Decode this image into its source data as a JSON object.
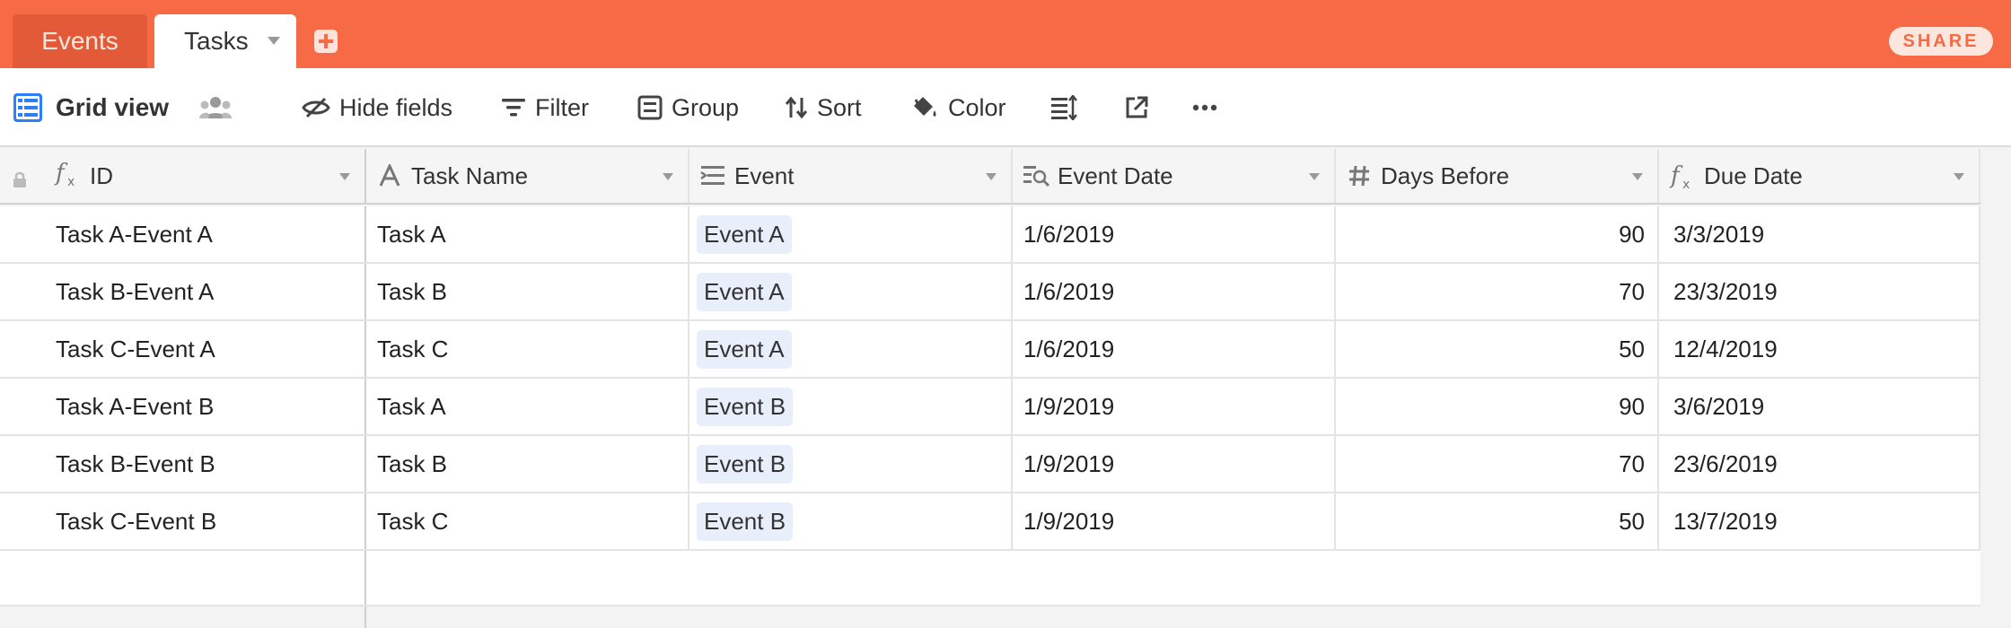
{
  "tabs": [
    {
      "label": "Events"
    },
    {
      "label": "Tasks"
    }
  ],
  "share_label": "SHARE",
  "toolbar": {
    "view_name": "Grid view",
    "hide_fields": "Hide fields",
    "filter": "Filter",
    "group": "Group",
    "sort": "Sort",
    "color": "Color"
  },
  "columns": [
    {
      "label": "ID",
      "icon": "formula-icon"
    },
    {
      "label": "Task Name",
      "icon": "text-icon"
    },
    {
      "label": "Event",
      "icon": "link-icon"
    },
    {
      "label": "Event Date",
      "icon": "lookup-icon"
    },
    {
      "label": "Days Before",
      "icon": "number-icon"
    },
    {
      "label": "Due Date",
      "icon": "formula-icon"
    }
  ],
  "rows": [
    {
      "id": "Task A-Event A",
      "task": "Task A",
      "event": "Event A",
      "event_date": "1/6/2019",
      "days_before": "90",
      "due_date": "3/3/2019"
    },
    {
      "id": "Task B-Event A",
      "task": "Task B",
      "event": "Event A",
      "event_date": "1/6/2019",
      "days_before": "70",
      "due_date": "23/3/2019"
    },
    {
      "id": "Task C-Event A",
      "task": "Task C",
      "event": "Event A",
      "event_date": "1/6/2019",
      "days_before": "50",
      "due_date": "12/4/2019"
    },
    {
      "id": "Task A-Event B",
      "task": "Task A",
      "event": "Event B",
      "event_date": "1/9/2019",
      "days_before": "90",
      "due_date": "3/6/2019"
    },
    {
      "id": "Task B-Event B",
      "task": "Task B",
      "event": "Event B",
      "event_date": "1/9/2019",
      "days_before": "70",
      "due_date": "23/6/2019"
    },
    {
      "id": "Task C-Event B",
      "task": "Task C",
      "event": "Event B",
      "event_date": "1/9/2019",
      "days_before": "50",
      "due_date": "13/7/2019"
    }
  ],
  "colors": {
    "brand": "#f66b46",
    "chip": "#e9eefb"
  }
}
